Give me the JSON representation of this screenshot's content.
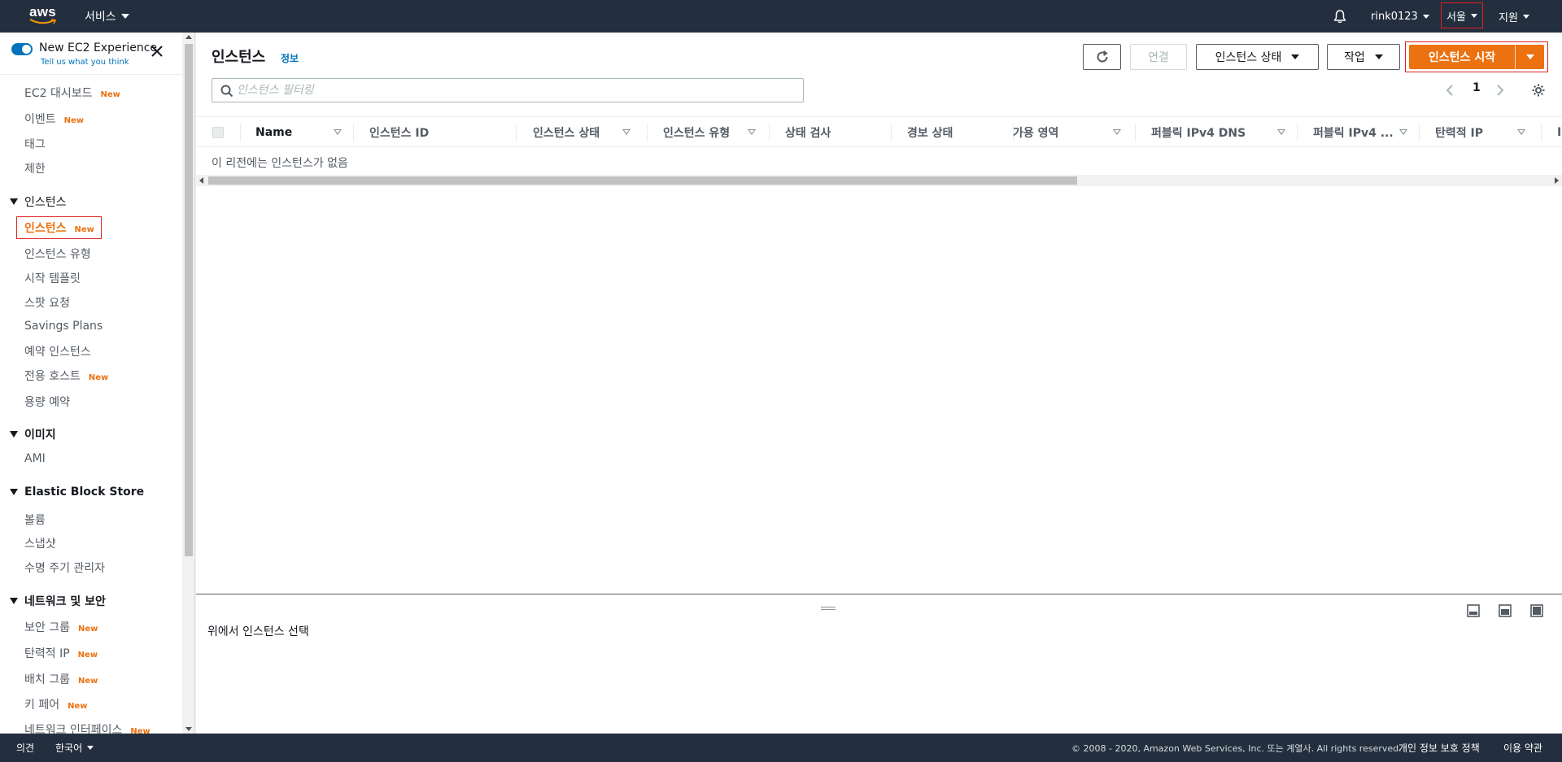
{
  "topnav": {
    "logo_text": "aws",
    "services_label": "서비스",
    "account_label": "rink0123",
    "region_label": "서울",
    "support_label": "지원",
    "bell_icon": "bell-icon"
  },
  "sidebar": {
    "experience": {
      "title": "New EC2 Experience",
      "subtitle": "Tell us what you think"
    },
    "new_badge": "New",
    "top_items": [
      {
        "label": "EC2 대시보드",
        "new": true
      },
      {
        "label": "이벤트",
        "new": true
      },
      {
        "label": "태그",
        "new": false
      },
      {
        "label": "제한",
        "new": false
      }
    ],
    "sections": [
      {
        "title": "인스턴스",
        "items": [
          {
            "label": "인스턴스",
            "new": true,
            "active": true
          },
          {
            "label": "인스턴스 유형",
            "new": false
          },
          {
            "label": "시작 템플릿",
            "new": false
          },
          {
            "label": "스팟 요청",
            "new": false
          },
          {
            "label": "Savings Plans",
            "new": false
          },
          {
            "label": "예약 인스턴스",
            "new": false
          },
          {
            "label": "전용 호스트",
            "new": true
          },
          {
            "label": "용량 예약",
            "new": false
          }
        ]
      },
      {
        "title": "이미지",
        "items": [
          {
            "label": "AMI",
            "new": false
          }
        ]
      },
      {
        "title": "Elastic Block Store",
        "items": [
          {
            "label": "볼륨",
            "new": false
          },
          {
            "label": "스냅샷",
            "new": false
          },
          {
            "label": "수명 주기 관리자",
            "new": false
          }
        ]
      },
      {
        "title": "네트워크 및 보안",
        "items": [
          {
            "label": "보안 그룹",
            "new": true
          },
          {
            "label": "탄력적 IP",
            "new": true
          },
          {
            "label": "배치 그룹",
            "new": true
          },
          {
            "label": "키 페어",
            "new": true
          },
          {
            "label": "네트워크 인터페이스",
            "new": true
          }
        ]
      }
    ]
  },
  "main": {
    "title": "인스턴스",
    "info_link": "정보",
    "connect_label": "연결",
    "instance_state_label": "인스턴스 상태",
    "actions_label": "작업",
    "launch_label": "인스턴스 시작",
    "search_placeholder": "인스턴스 필터링",
    "page_number": "1",
    "columns": [
      {
        "label": "Name",
        "sortable": true
      },
      {
        "label": "인스턴스 ID",
        "sortable": false
      },
      {
        "label": "인스턴스 상태",
        "sortable": true
      },
      {
        "label": "인스턴스 유형",
        "sortable": true
      },
      {
        "label": "상태 검사",
        "sortable": false
      },
      {
        "label": "경보 상태",
        "sortable": false
      },
      {
        "label": "가용 영역",
        "sortable": true
      },
      {
        "label": "퍼블릭 IPv4 DNS",
        "sortable": true
      },
      {
        "label": "퍼블릭 IPv4 ...",
        "sortable": true
      },
      {
        "label": "탄력적 IP",
        "sortable": true
      },
      {
        "label": "I",
        "sortable": false
      }
    ],
    "empty_message": "이 리전에는 인스턴스가 없음"
  },
  "detail_panel": {
    "message": "위에서 인스턴스 선택"
  },
  "footer": {
    "feedback_label": "의견",
    "language_label": "한국어",
    "copyright": "© 2008 - 2020, Amazon Web Services, Inc. 또는 계열사. All rights reserved.",
    "privacy_label": "개인 정보 보호 정책",
    "terms_label": "이용 약관"
  },
  "colors": {
    "nav_bg": "#232f3e",
    "accent_orange": "#ec7211",
    "link_blue": "#0073bb",
    "highlight_red": "#e02020"
  }
}
